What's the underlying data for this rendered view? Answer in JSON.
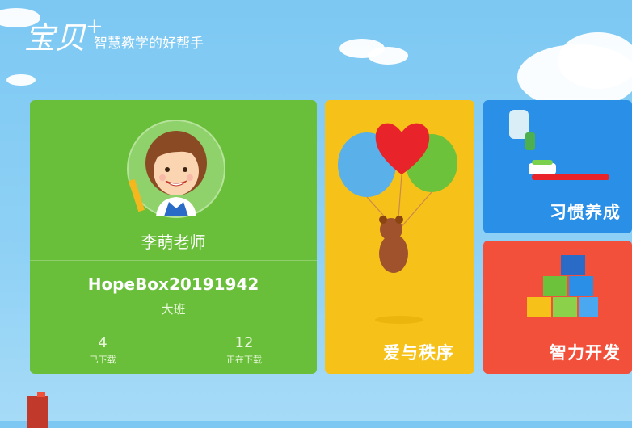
{
  "header": {
    "logo_text": "宝贝",
    "logo_plus": "+",
    "slogan": "智慧教学的好帮手"
  },
  "profile": {
    "teacher_name": "李萌老师",
    "account_id": "HopeBox20191942",
    "class_name": "大班",
    "stats": [
      {
        "value": "4",
        "label": "已下载"
      },
      {
        "value": "12",
        "label": "正在下载"
      }
    ]
  },
  "modules": [
    {
      "label": "爱与秩序",
      "color": "#f6c21a"
    },
    {
      "label": "习惯养成",
      "color": "#2a8fe6"
    },
    {
      "label": "智力开发",
      "color": "#f2503a"
    }
  ]
}
